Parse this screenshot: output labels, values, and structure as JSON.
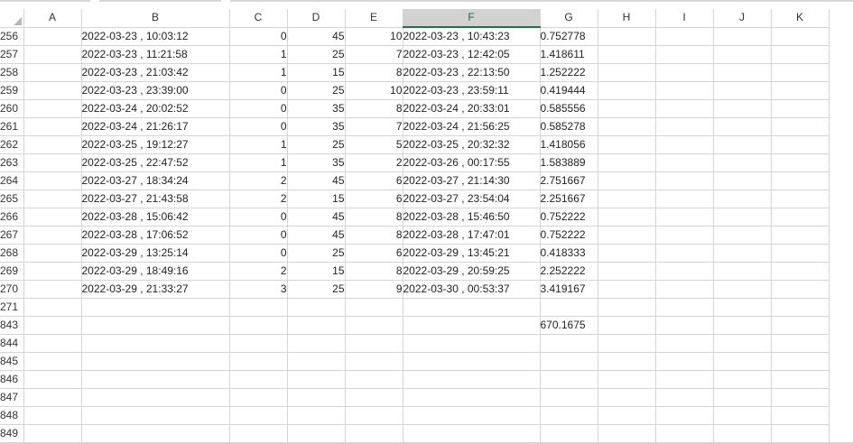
{
  "sheet": {
    "columns": [
      "A",
      "B",
      "C",
      "D",
      "E",
      "F",
      "G",
      "H",
      "I",
      "J",
      "K"
    ],
    "selected_column": "F",
    "rows": [
      {
        "num": "256",
        "b": "2022-03-23 , 10:03:12",
        "c": "0",
        "d": "45",
        "e": "10",
        "f": "2022-03-23 , 10:43:23",
        "g": "0.752778"
      },
      {
        "num": "257",
        "b": "2022-03-23 , 11:21:58",
        "c": "1",
        "d": "25",
        "e": "7",
        "f": "2022-03-23 , 12:42:05",
        "g": "1.418611"
      },
      {
        "num": "258",
        "b": "2022-03-23 , 21:03:42",
        "c": "1",
        "d": "15",
        "e": "8",
        "f": "2022-03-23 , 22:13:50",
        "g": "1.252222"
      },
      {
        "num": "259",
        "b": "2022-03-23 , 23:39:00",
        "c": "0",
        "d": "25",
        "e": "10",
        "f": "2022-03-23 , 23:59:11",
        "g": "0.419444"
      },
      {
        "num": "260",
        "b": "2022-03-24 , 20:02:52",
        "c": "0",
        "d": "35",
        "e": "8",
        "f": "2022-03-24 , 20:33:01",
        "g": "0.585556"
      },
      {
        "num": "261",
        "b": "2022-03-24 , 21:26:17",
        "c": "0",
        "d": "35",
        "e": "7",
        "f": "2022-03-24 , 21:56:25",
        "g": "0.585278"
      },
      {
        "num": "262",
        "b": "2022-03-25 , 19:12:27",
        "c": "1",
        "d": "25",
        "e": "5",
        "f": "2022-03-25 , 20:32:32",
        "g": "1.418056"
      },
      {
        "num": "263",
        "b": "2022-03-25 , 22:47:52",
        "c": "1",
        "d": "35",
        "e": "2",
        "f": "2022-03-26 , 00:17:55",
        "g": "1.583889"
      },
      {
        "num": "264",
        "b": "2022-03-27 , 18:34:24",
        "c": "2",
        "d": "45",
        "e": "6",
        "f": "2022-03-27 , 21:14:30",
        "g": "2.751667"
      },
      {
        "num": "265",
        "b": "2022-03-27 , 21:43:58",
        "c": "2",
        "d": "15",
        "e": "6",
        "f": "2022-03-27 , 23:54:04",
        "g": "2.251667"
      },
      {
        "num": "266",
        "b": "2022-03-28 , 15:06:42",
        "c": "0",
        "d": "45",
        "e": "8",
        "f": "2022-03-28 , 15:46:50",
        "g": "0.752222"
      },
      {
        "num": "267",
        "b": "2022-03-28 , 17:06:52",
        "c": "0",
        "d": "45",
        "e": "8",
        "f": "2022-03-28 , 17:47:01",
        "g": "0.752222"
      },
      {
        "num": "268",
        "b": "2022-03-29 , 13:25:14",
        "c": "0",
        "d": "25",
        "e": "6",
        "f": "2022-03-29 , 13:45:21",
        "g": "0.418333"
      },
      {
        "num": "269",
        "b": "2022-03-29 , 18:49:16",
        "c": "2",
        "d": "15",
        "e": "8",
        "f": "2022-03-29 , 20:59:25",
        "g": "2.252222"
      },
      {
        "num": "270",
        "b": "2022-03-29 , 21:33:27",
        "c": "3",
        "d": "25",
        "e": "9",
        "f": "2022-03-30 , 00:53:37",
        "g": "3.419167"
      },
      {
        "num": "271",
        "b": "",
        "c": "",
        "d": "",
        "e": "",
        "f": "",
        "g": ""
      },
      {
        "num": "843",
        "b": "",
        "c": "",
        "d": "",
        "e": "",
        "f": "",
        "g": "670.1675"
      },
      {
        "num": "844",
        "b": "",
        "c": "",
        "d": "",
        "e": "",
        "f": "",
        "g": ""
      },
      {
        "num": "845",
        "b": "",
        "c": "",
        "d": "",
        "e": "",
        "f": "",
        "g": ""
      },
      {
        "num": "846",
        "b": "",
        "c": "",
        "d": "",
        "e": "",
        "f": "",
        "g": ""
      },
      {
        "num": "847",
        "b": "",
        "c": "",
        "d": "",
        "e": "",
        "f": "",
        "g": ""
      },
      {
        "num": "848",
        "b": "",
        "c": "",
        "d": "",
        "e": "",
        "f": "",
        "g": ""
      },
      {
        "num": "849",
        "b": "",
        "c": "",
        "d": "",
        "e": "",
        "f": "",
        "g": ""
      }
    ]
  }
}
